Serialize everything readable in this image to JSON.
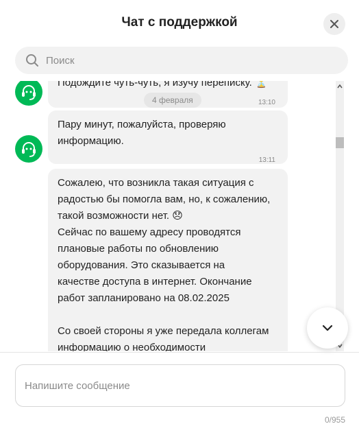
{
  "header": {
    "title": "Чат с поддержкой",
    "close_icon": "close-icon"
  },
  "search": {
    "placeholder": "Поиск",
    "icon": "search-icon"
  },
  "colors": {
    "accent": "#00b956",
    "bubble": "#f2f2f2"
  },
  "messages": [
    {
      "text": "Подождите чуть-чуть, я изучу переписку. ⏳",
      "time": "13:10"
    },
    {
      "date": "4 февраля"
    },
    {
      "text": "Пару минут, пожалуйста, проверяю информацию.",
      "time": "13:11"
    },
    {
      "lines": [
        "Сожалею, что возникла такая ситуация с",
        "радостью бы помогла вам, но, к сожалению,",
        "такой возможности нет. 😞",
        "Сейчас по вашему адресу проводятся",
        "плановые работы по обновлению",
        "оборудования. Это сказывается на",
        "качестве доступа в интернет. Окончание",
        "работ запланировано на 08.02.2025",
        "",
        "Со своей стороны я уже передала коллегам",
        "информацию о необходимости"
      ]
    }
  ],
  "composer": {
    "placeholder": "Напишите сообщение",
    "counter": "0/955"
  },
  "scroll_button_icon": "chevron-down-icon"
}
